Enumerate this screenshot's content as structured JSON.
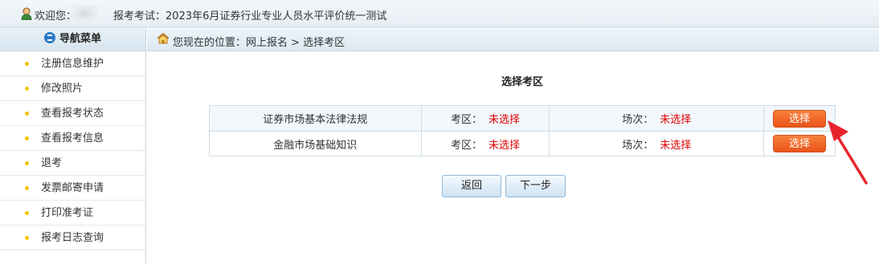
{
  "header": {
    "welcome": "欢迎您：",
    "exam_label": "报考考试：2023年6月证券行业专业人员水平评价统一测试"
  },
  "sidebar": {
    "title": "导航菜单",
    "items": [
      {
        "label": "注册信息维护"
      },
      {
        "label": "修改照片"
      },
      {
        "label": "查看报考状态"
      },
      {
        "label": "查看报考信息"
      },
      {
        "label": "退考"
      },
      {
        "label": "发票邮寄申请"
      },
      {
        "label": "打印准考证"
      },
      {
        "label": "报考日志查询"
      }
    ]
  },
  "breadcrumb": {
    "text": "您现在的位置：网上报名 > 选择考区"
  },
  "main": {
    "title": "选择考区",
    "rows": [
      {
        "subject": "证券市场基本法律法规",
        "area_label": "考区：",
        "area_value": "未选择",
        "session_label": "场次：",
        "session_value": "未选择",
        "button": "选择"
      },
      {
        "subject": "金融市场基础知识",
        "area_label": "考区：",
        "area_value": "未选择",
        "session_label": "场次：",
        "session_value": "未选择",
        "button": "选择"
      }
    ],
    "back_button": "返回",
    "next_button": "下一步"
  },
  "colors": {
    "accent": "#ef6a2a",
    "status_red": "#e00000",
    "arrow": "#e8242b"
  }
}
